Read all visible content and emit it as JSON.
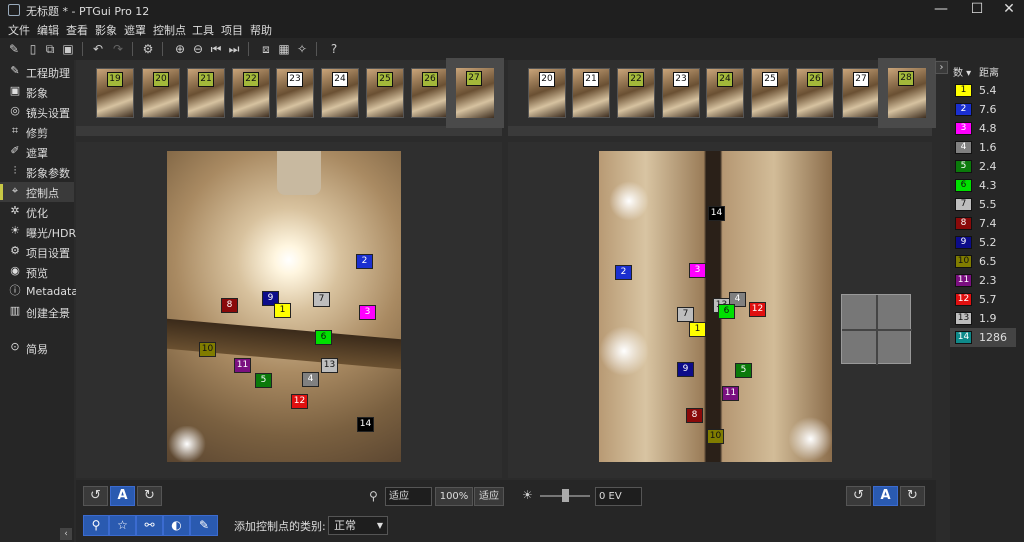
{
  "window": {
    "title": "无标题 * - PTGui Pro 12",
    "min": "—",
    "max": "☐",
    "close": "✕"
  },
  "menu": [
    "文件",
    "编辑",
    "查看",
    "影象",
    "遮罩",
    "控制点",
    "工具",
    "项目",
    "帮助"
  ],
  "sidebar": {
    "items": [
      {
        "icon": "✎",
        "label": "工程助理"
      },
      {
        "icon": "▣",
        "label": "影象"
      },
      {
        "icon": "◎",
        "label": "镜头设置"
      },
      {
        "icon": "⌗",
        "label": "修剪"
      },
      {
        "icon": "✐",
        "label": "遮罩"
      },
      {
        "icon": "⫶",
        "label": "影象参数"
      },
      {
        "icon": "⌖",
        "label": "控制点"
      },
      {
        "icon": "✲",
        "label": "优化"
      },
      {
        "icon": "☀",
        "label": "曝光/HDR"
      },
      {
        "icon": "⚙",
        "label": "项目设置"
      },
      {
        "icon": "◉",
        "label": "预览"
      },
      {
        "icon": "ⓘ",
        "label": "Metadata"
      },
      {
        "icon": "▥",
        "label": "创建全景"
      }
    ],
    "simple": {
      "icon": "⊙",
      "label": "简易"
    },
    "collapse": "‹"
  },
  "left_thumbs": [
    {
      "n": "19",
      "color": "#a3b83a"
    },
    {
      "n": "20",
      "color": "#a3b83a"
    },
    {
      "n": "21",
      "color": "#a3b83a"
    },
    {
      "n": "22",
      "color": "#a3b83a"
    },
    {
      "n": "23",
      "color": "#ffffff"
    },
    {
      "n": "24",
      "color": "#ffffff"
    },
    {
      "n": "25",
      "color": "#a3b83a"
    },
    {
      "n": "26",
      "color": "#a3b83a"
    },
    {
      "n": "27",
      "color": "#a3b83a"
    }
  ],
  "right_thumbs": [
    {
      "n": "20",
      "color": "#ffffff"
    },
    {
      "n": "21",
      "color": "#ffffff"
    },
    {
      "n": "22",
      "color": "#a3b83a"
    },
    {
      "n": "23",
      "color": "#ffffff"
    },
    {
      "n": "24",
      "color": "#a3b83a"
    },
    {
      "n": "25",
      "color": "#ffffff"
    },
    {
      "n": "26",
      "color": "#a3b83a"
    },
    {
      "n": "27",
      "color": "#ffffff"
    },
    {
      "n": "28",
      "color": "#a3b83a"
    }
  ],
  "left_points": [
    {
      "n": "2",
      "color": "#1a2fd0"
    },
    {
      "n": "9",
      "color": "#0c0c8a"
    },
    {
      "n": "7",
      "color": "#bdbdbd"
    },
    {
      "n": "8",
      "color": "#8a0a0a"
    },
    {
      "n": "1",
      "color": "#ffff00"
    },
    {
      "n": "3",
      "color": "#ff00ff"
    },
    {
      "n": "6",
      "color": "#00e000"
    },
    {
      "n": "10",
      "color": "#807c00"
    },
    {
      "n": "13",
      "color": "#bdbdbd"
    },
    {
      "n": "11",
      "color": "#7a1080"
    },
    {
      "n": "5",
      "color": "#0b7a0b"
    },
    {
      "n": "4",
      "color": "#808080"
    },
    {
      "n": "12",
      "color": "#e01010"
    },
    {
      "n": "14",
      "color": "#000000"
    }
  ],
  "right_points": [
    {
      "n": "14",
      "color": "#000000"
    },
    {
      "n": "2",
      "color": "#1a2fd0"
    },
    {
      "n": "3",
      "color": "#ff00ff"
    },
    {
      "n": "13",
      "color": "#bdbdbd"
    },
    {
      "n": "4",
      "color": "#808080"
    },
    {
      "n": "6",
      "color": "#00e000"
    },
    {
      "n": "12",
      "color": "#e01010"
    },
    {
      "n": "7",
      "color": "#bdbdbd"
    },
    {
      "n": "1",
      "color": "#ffff00"
    },
    {
      "n": "9",
      "color": "#0c0c8a"
    },
    {
      "n": "5",
      "color": "#0b7a0b"
    },
    {
      "n": "11",
      "color": "#7a1080"
    },
    {
      "n": "8",
      "color": "#8a0a0a"
    },
    {
      "n": "10",
      "color": "#807c00"
    }
  ],
  "bottom": {
    "zoom_value": "适应",
    "zoom_100": "100%",
    "fit_label": "适应",
    "ev_value": "0 EV",
    "rotate_left": "↺",
    "auto": "A",
    "rotate_right": "↻",
    "add_type_label": "添加控制点的类别:",
    "add_type_value": "正常",
    "tools": [
      "⚲",
      "☆",
      "⚯",
      "◐",
      "✎"
    ]
  },
  "table": {
    "expand": "›",
    "col_num": "数 ▾",
    "col_dist": "距离",
    "rows": [
      {
        "n": "1",
        "color": "#ffff00",
        "dist": "5.4"
      },
      {
        "n": "2",
        "color": "#1a2fd0",
        "dist": "7.6"
      },
      {
        "n": "3",
        "color": "#ff00ff",
        "dist": "4.8"
      },
      {
        "n": "4",
        "color": "#808080",
        "dist": "1.6"
      },
      {
        "n": "5",
        "color": "#0b7a0b",
        "dist": "2.4"
      },
      {
        "n": "6",
        "color": "#00e000",
        "dist": "4.3"
      },
      {
        "n": "7",
        "color": "#bdbdbd",
        "dist": "5.5"
      },
      {
        "n": "8",
        "color": "#8a0a0a",
        "dist": "7.4"
      },
      {
        "n": "9",
        "color": "#0c0c8a",
        "dist": "5.2"
      },
      {
        "n": "10",
        "color": "#807c00",
        "dist": "6.5"
      },
      {
        "n": "11",
        "color": "#7a1080",
        "dist": "2.3"
      },
      {
        "n": "12",
        "color": "#e01010",
        "dist": "5.7"
      },
      {
        "n": "13",
        "color": "#bdbdbd",
        "dist": "1.9"
      },
      {
        "n": "14",
        "color": "#0e8a8a",
        "dist": "1286"
      }
    ]
  }
}
